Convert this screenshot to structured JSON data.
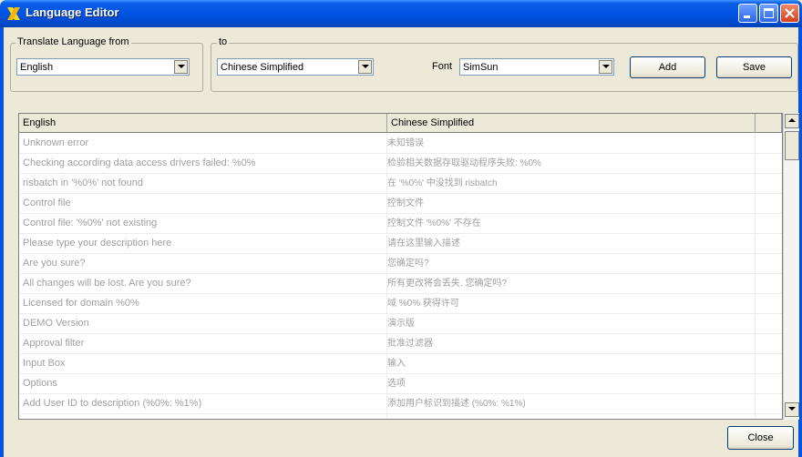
{
  "window": {
    "title": "Language Editor"
  },
  "toolbar": {
    "from_label": "Translate Language from",
    "from_value": "English",
    "to_label": "to",
    "to_value": "Chinese Simplified",
    "font_label": "Font",
    "font_value": "SimSun",
    "add_label": "Add",
    "save_label": "Save"
  },
  "grid": {
    "columns": [
      "English",
      "Chinese Simplified"
    ],
    "rows": [
      [
        "Unknown error",
        "未知错误"
      ],
      [
        "Checking according data access drivers failed: %0%",
        "检验相关数据存取驱动程序失败: %0%"
      ],
      [
        "risbatch in '%0%' not found",
        "在 '%0%' 中没找到 risbatch"
      ],
      [
        "Control file",
        "控制文件"
      ],
      [
        "Control file: '%0%' not existing",
        "控制文件 '%0%' 不存在"
      ],
      [
        "Please type your description here",
        "请在这里输入描述"
      ],
      [
        "Are you sure?",
        "您确定吗?"
      ],
      [
        "All changes will be lost. Are you sure?",
        "所有更改将会丢失. 您确定吗?"
      ],
      [
        "Licensed for domain %0%",
        "域 %0% 获得许可"
      ],
      [
        "DEMO Version",
        "演示版"
      ],
      [
        "Approval filter",
        "批准过滤器"
      ],
      [
        "Input Box",
        "输入"
      ],
      [
        "Options",
        "选项"
      ],
      [
        "Add User ID to description (%0%: %1%)",
        "添加用户标识到描述 (%0%: %1%)"
      ]
    ]
  },
  "footer": {
    "close_label": "Close"
  },
  "icons": [
    "app-x-icon",
    "minimize-icon",
    "maximize-icon",
    "close-icon",
    "dropdown-arrow-icon",
    "scroll-up-icon",
    "scroll-down-icon"
  ],
  "colors": {
    "titlebar": "#0054e3",
    "face": "#ece9d8",
    "muted_text": "#a0a0a0"
  }
}
